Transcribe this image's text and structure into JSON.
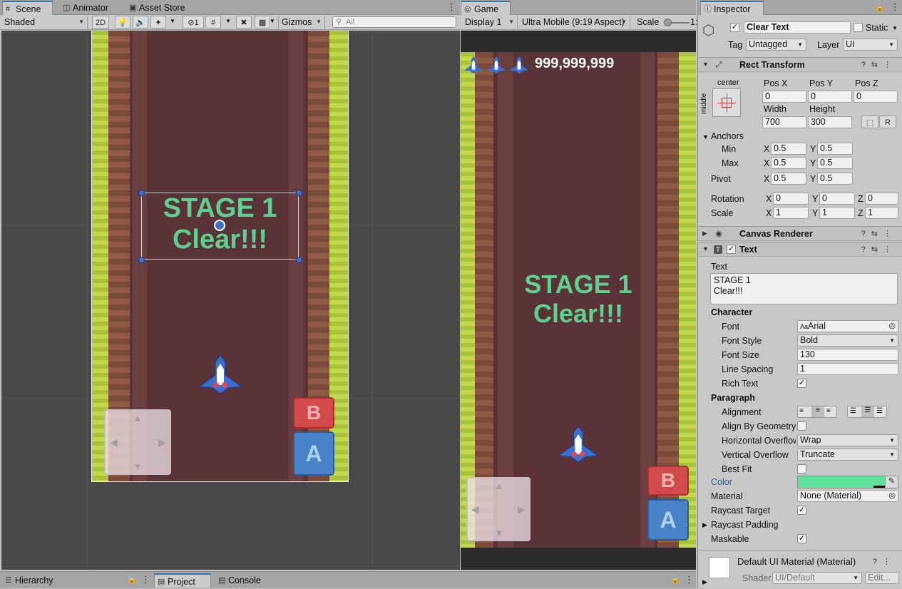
{
  "scene_tabs": [
    {
      "label": "Scene",
      "icon": "#"
    },
    {
      "label": "Animator",
      "icon": "✇"
    },
    {
      "label": "Asset Store",
      "icon": "■"
    }
  ],
  "scene_toolbar": {
    "shading": "Shaded",
    "btn_2d": "2D",
    "hidden_count": "1",
    "gizmos": "Gizmos",
    "search_placeholder": "All"
  },
  "scene": {
    "stage_line1": "STAGE 1",
    "stage_line2": "Clear!!!",
    "btn_b": "B",
    "btn_a": "A"
  },
  "game_tab": {
    "label": "Game",
    "icon": "◎"
  },
  "game_toolbar": {
    "display": "Display 1",
    "aspect": "Ultra Mobile (9:19 Aspect)",
    "scale_label": "Scale",
    "scale_value": "1:"
  },
  "game": {
    "score": "999,999,999",
    "stage_line1": "STAGE 1",
    "stage_line2": "Clear!!!",
    "btn_b": "B",
    "btn_a": "A"
  },
  "inspector": {
    "tab_label": "Inspector",
    "object_name": "Clear Text",
    "static_label": "Static",
    "tag_label": "Tag",
    "tag_value": "Untagged",
    "layer_label": "Layer",
    "layer_value": "UI",
    "rect_transform": {
      "title": "Rect Transform",
      "anchor_h": "center",
      "anchor_v": "middle",
      "pos_x_label": "Pos X",
      "pos_y_label": "Pos Y",
      "pos_z_label": "Pos Z",
      "pos_x": "0",
      "pos_y": "0",
      "pos_z": "0",
      "width_label": "Width",
      "height_label": "Height",
      "width": "700",
      "height": "300",
      "r_button": "R",
      "anchors_label": "Anchors",
      "min_label": "Min",
      "max_label": "Max",
      "min_x": "0.5",
      "min_y": "0.5",
      "max_x": "0.5",
      "max_y": "0.5",
      "pivot_label": "Pivot",
      "pivot_x": "0.5",
      "pivot_y": "0.5",
      "rotation_label": "Rotation",
      "rot_x": "0",
      "rot_y": "0",
      "rot_z": "0",
      "scale_label": "Scale",
      "scale_x": "1",
      "scale_y": "1",
      "scale_z": "1",
      "x": "X",
      "y": "Y",
      "z": "Z"
    },
    "canvas_renderer": {
      "title": "Canvas Renderer"
    },
    "text_comp": {
      "title": "Text",
      "text_label": "Text",
      "text_line1": "STAGE 1",
      "text_line2": "Clear!!!",
      "character_label": "Character",
      "font_label": "Font",
      "font_value": "Arial",
      "font_prefix": "Aa",
      "font_style_label": "Font Style",
      "font_style_value": "Bold",
      "font_size_label": "Font Size",
      "font_size_value": "130",
      "line_spacing_label": "Line Spacing",
      "line_spacing_value": "1",
      "rich_text_label": "Rich Text",
      "paragraph_label": "Paragraph",
      "alignment_label": "Alignment",
      "align_geom_label": "Align By Geometry",
      "h_overflow_label": "Horizontal Overflow",
      "h_overflow_value": "Wrap",
      "v_overflow_label": "Vertical Overflow",
      "v_overflow_value": "Truncate",
      "best_fit_label": "Best Fit",
      "color_label": "Color",
      "color_value": "#5fe39a",
      "material_label": "Material",
      "material_value": "None (Material)",
      "raycast_target_label": "Raycast Target",
      "raycast_padding_label": "Raycast Padding",
      "maskable_label": "Maskable"
    },
    "material": {
      "name": "Default UI Material (Material)",
      "shader_label": "Shader",
      "shader_value": "UI/Default",
      "edit_label": "Edit..."
    }
  },
  "bottom_tabs": [
    {
      "label": "Hierarchy",
      "icon": "☰"
    },
    {
      "label": "Project",
      "icon": "▤"
    },
    {
      "label": "Console",
      "icon": "▤"
    }
  ],
  "colors": {
    "accent_blue": "#3a72b0",
    "text_green": "#5fd08e",
    "road": "#5a3338",
    "grass": "#a9c43c"
  }
}
